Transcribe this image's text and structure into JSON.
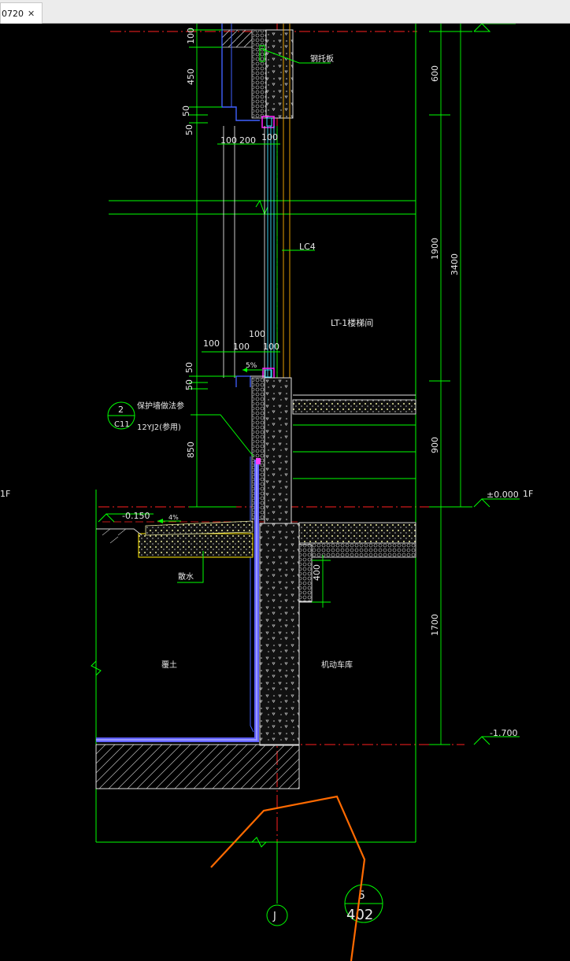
{
  "tab": {
    "title": "0720",
    "close_glyph": "✕"
  },
  "drawing": {
    "dims_left": [
      "100",
      "450",
      "50",
      "50",
      "100",
      "200",
      "100",
      "100",
      "100",
      "100",
      "100",
      "50",
      "50",
      "850"
    ],
    "dims_right": [
      "600",
      "1900",
      "3400",
      "900",
      "1700",
      "400"
    ],
    "slope_top": "5%",
    "slope_bottom": "4%",
    "label_steel_plate": "钢托板",
    "label_lc4": "LC4",
    "label_stairwell": "LT-1楼梯间",
    "label_waterproof": "保护墙做法参",
    "label_standard": "12YJ2(参用)",
    "label_blind_ditch": "散水",
    "label_backfill": "覆土",
    "label_garage": "机动车库",
    "callout_top": "2",
    "callout_bottom": "C11",
    "elev_0": "±0.000",
    "elev_floor": "1F",
    "elev_edge_left": "1F",
    "elev_m0150": "-0.150",
    "elev_m1700": "-1.700",
    "grid_axis": "J",
    "detail_top": "5",
    "detail_bottom": "402",
    "colors": {
      "dim": "#00ff00",
      "axis_red": "#ff2020",
      "wall_white": "#e0e0e0",
      "blue": "#4040ff",
      "orange": "#ff6a00"
    }
  }
}
